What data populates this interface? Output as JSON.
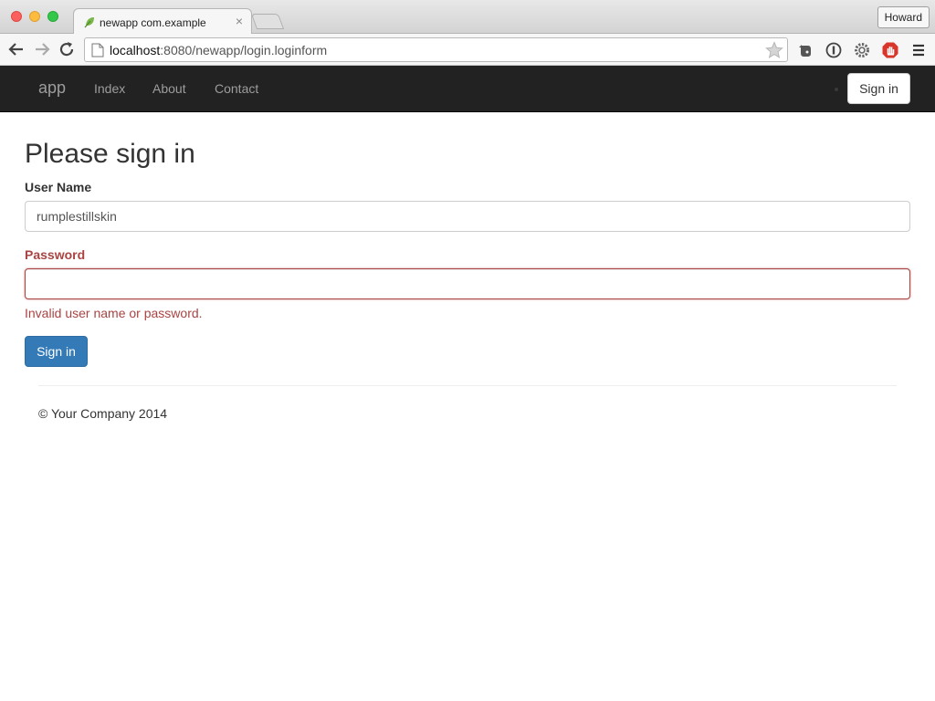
{
  "browser": {
    "tab_title": "newapp com.example",
    "tab_close": "×",
    "profile_name": "Howard",
    "url_host": "localhost",
    "url_rest": ":8080/newapp/login.loginform"
  },
  "navbar": {
    "brand": "app",
    "links": [
      "Index",
      "About",
      "Contact"
    ],
    "signin_label": "Sign in"
  },
  "form": {
    "heading": "Please sign in",
    "username_label": "User Name",
    "username_value": "rumplestillskin",
    "password_label": "Password",
    "password_value": "",
    "error_message": "Invalid user name or password.",
    "submit_label": "Sign in"
  },
  "footer": {
    "text": "© Your Company 2014"
  },
  "colors": {
    "navbar_bg": "#222222",
    "error": "#a94442",
    "primary": "#337ab7"
  }
}
